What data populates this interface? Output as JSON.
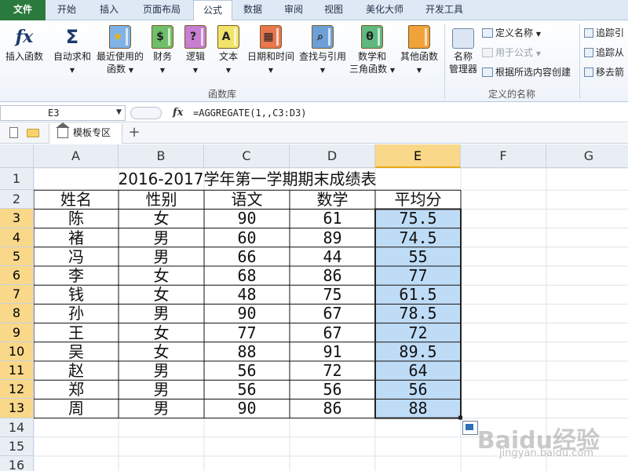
{
  "tabs": [
    {
      "label": "文件",
      "kind": "file"
    },
    {
      "label": "开始"
    },
    {
      "label": "插入"
    },
    {
      "label": "页面布局"
    },
    {
      "label": "公式",
      "active": true
    },
    {
      "label": "数据"
    },
    {
      "label": "审阅"
    },
    {
      "label": "视图"
    },
    {
      "label": "美化大师"
    },
    {
      "label": "开发工具"
    }
  ],
  "ribbon": {
    "insert_function": "插入函数",
    "autosum_l1": "自动求和",
    "recent_l1": "最近使用的",
    "recent_l2": "函数",
    "finance": "财务",
    "logic": "逻辑",
    "text": "文本",
    "datetime": "日期和时间",
    "lookup": "查找与引用",
    "math_l1": "数学和",
    "math_l2": "三角函数",
    "other": "其他函数",
    "name_mgr_l1": "名称",
    "name_mgr_l2": "管理器",
    "define_name": "定义名称",
    "use_in_formula": "用于公式",
    "create_from_sel": "根据所选内容创建",
    "trace_prec": "追踪引",
    "trace_dep": "追踪从",
    "remove_arrows": "移去箭",
    "group_function_lib": "函数库",
    "group_defined_names": "定义的名称"
  },
  "formula_bar": {
    "name_box": "E3",
    "fx": "fx",
    "formula": "=AGGREGATE(1,,C3:D3)"
  },
  "sheet_tabs": {
    "active": "模板专区",
    "add": "+"
  },
  "columns": [
    "A",
    "B",
    "C",
    "D",
    "E",
    "F",
    "G"
  ],
  "rows": [
    "1",
    "2",
    "3",
    "4",
    "5",
    "6",
    "7",
    "8",
    "9",
    "10",
    "11",
    "12",
    "13",
    "14",
    "15",
    "16"
  ],
  "sheet": {
    "title": "2016-2017学年第一学期期末成绩表",
    "headers": [
      "姓名",
      "性别",
      "语文",
      "数学",
      "平均分"
    ],
    "data": [
      [
        "陈",
        "女",
        "90",
        "61",
        "75.5"
      ],
      [
        "褚",
        "男",
        "60",
        "89",
        "74.5"
      ],
      [
        "冯",
        "男",
        "66",
        "44",
        "55"
      ],
      [
        "李",
        "女",
        "68",
        "86",
        "77"
      ],
      [
        "钱",
        "女",
        "48",
        "75",
        "61.5"
      ],
      [
        "孙",
        "男",
        "90",
        "67",
        "78.5"
      ],
      [
        "王",
        "女",
        "77",
        "67",
        "72"
      ],
      [
        "吴",
        "女",
        "88",
        "91",
        "89.5"
      ],
      [
        "赵",
        "男",
        "56",
        "72",
        "64"
      ],
      [
        "郑",
        "男",
        "56",
        "56",
        "56"
      ],
      [
        "周",
        "男",
        "90",
        "86",
        "88"
      ]
    ]
  },
  "watermark": {
    "brand": "Baidu经验",
    "url": "jingyan.baidu.com"
  },
  "colors": {
    "selection_fill": "#bfdcf7",
    "file_tab": "#2b7a3d",
    "header_highlight": "#f9d88a"
  }
}
